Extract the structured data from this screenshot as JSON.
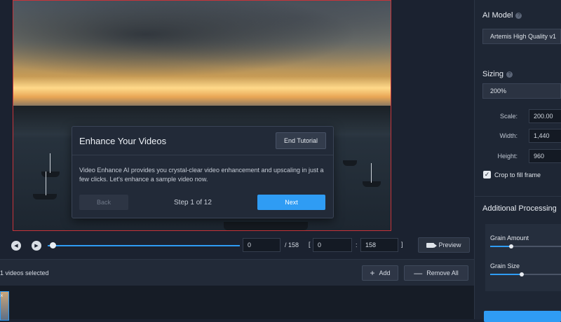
{
  "tutorial": {
    "title": "Enhance Your Videos",
    "end_label": "End Tutorial",
    "body": "Video Enhance AI provides you crystal-clear video enhancement and upscaling in just a few clicks. Let's enhance a sample video now.",
    "back_label": "Back",
    "step": "Step 1 of 12",
    "next_label": "Next"
  },
  "timeline": {
    "frame": "0",
    "total": "/ 158",
    "open_bracket": "[",
    "range_start": "0",
    "colon": ":",
    "range_end": "158",
    "close_bracket": "]",
    "preview_label": "Preview",
    "position": 0
  },
  "file_list": {
    "selected_text": "1 videos selected",
    "add_label": "Add",
    "remove_all_label": "Remove All",
    "close_glyph": "×"
  },
  "panel": {
    "ai_model_heading": "AI Model",
    "ai_model_value": "Artemis High Quality v1",
    "sizing_heading": "Sizing",
    "sizing_value": "200%",
    "scale_label": "Scale:",
    "scale_value": "200.00",
    "width_label": "Width:",
    "width_value": "1,440",
    "height_label": "Height:",
    "height_value": "960",
    "crop_label": "Crop to fill frame",
    "crop_checked": true,
    "additional_heading": "Additional Processing",
    "grain_amount_label": "Grain Amount",
    "grain_amount_level": 0.3,
    "grain_size_label": "Grain Size",
    "grain_size_level": 0.45
  },
  "colors": {
    "accent": "#2f9cf4",
    "selection_border": "#c8343a",
    "background": "#1b2230"
  }
}
